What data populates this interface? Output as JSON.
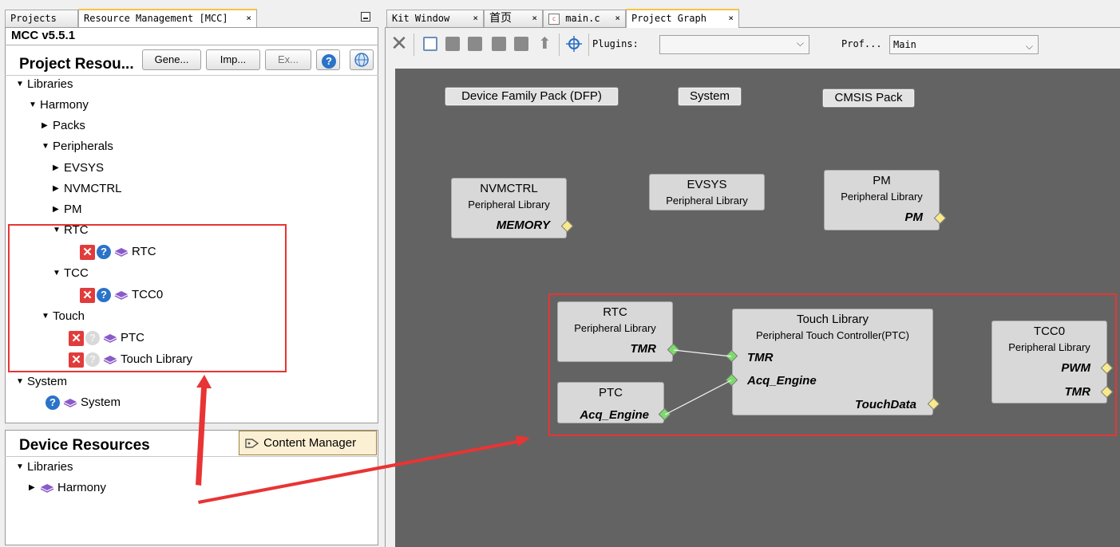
{
  "left_tabs": [
    {
      "label": "Projects"
    },
    {
      "label": "Resource Management [MCC]"
    }
  ],
  "right_tabs": [
    {
      "label": "Kit Window"
    },
    {
      "label": "首页"
    },
    {
      "label": "main.c"
    },
    {
      "label": "Project Graph"
    }
  ],
  "close_glyph": "×",
  "mcc_version": "MCC v5.5.1",
  "project_resources": {
    "title": "Project Resou...",
    "buttons": {
      "generate": "Gene...",
      "import": "Imp...",
      "export": "Ex..."
    }
  },
  "tree": {
    "libraries": "Libraries",
    "harmony": "Harmony",
    "packs": "Packs",
    "peripherals": "Peripherals",
    "evsys": "EVSYS",
    "nvmctrl": "NVMCTRL",
    "pm": "PM",
    "rtc": "RTC",
    "rtc_item": "RTC",
    "tcc": "TCC",
    "tcc_item": "TCC0",
    "touch": "Touch",
    "ptc_item": "PTC",
    "touch_lib_item": "Touch Library",
    "system": "System",
    "system_item": "System"
  },
  "device_resources": {
    "title": "Device Resources",
    "content_manager": "Content Manager",
    "libraries": "Libraries",
    "harmony": "Harmony"
  },
  "toolbar": {
    "plugins_label": "Plugins:",
    "plugins_value": "",
    "profile_label": "Prof...",
    "profile_value": "Main"
  },
  "graph": {
    "packs": {
      "dfp": "Device Family Pack (DFP)",
      "system": "System",
      "cmsis": "CMSIS Pack"
    },
    "nvmctrl": {
      "title": "NVMCTRL",
      "sub": "Peripheral Library",
      "port": "MEMORY"
    },
    "evsys": {
      "title": "EVSYS",
      "sub": "Peripheral Library"
    },
    "pm": {
      "title": "PM",
      "sub": "Peripheral Library",
      "port": "PM"
    },
    "rtc": {
      "title": "RTC",
      "sub": "Peripheral Library",
      "port": "TMR"
    },
    "ptc": {
      "title": "PTC",
      "port": "Acq_Engine"
    },
    "touch": {
      "title": "Touch Library",
      "sub": "Peripheral Touch Controller(PTC)",
      "port_tmr": "TMR",
      "port_acq": "Acq_Engine",
      "port_data": "TouchData"
    },
    "tcc0": {
      "title": "TCC0",
      "sub": "Peripheral Library",
      "port_pwm": "PWM",
      "port_tmr": "TMR"
    }
  },
  "colors": {
    "highlight": "#e83434",
    "canvas": "#636363",
    "node": "#d8d8d8",
    "required_port": "#7ddc6b",
    "optional_port": "#f7e98c"
  }
}
